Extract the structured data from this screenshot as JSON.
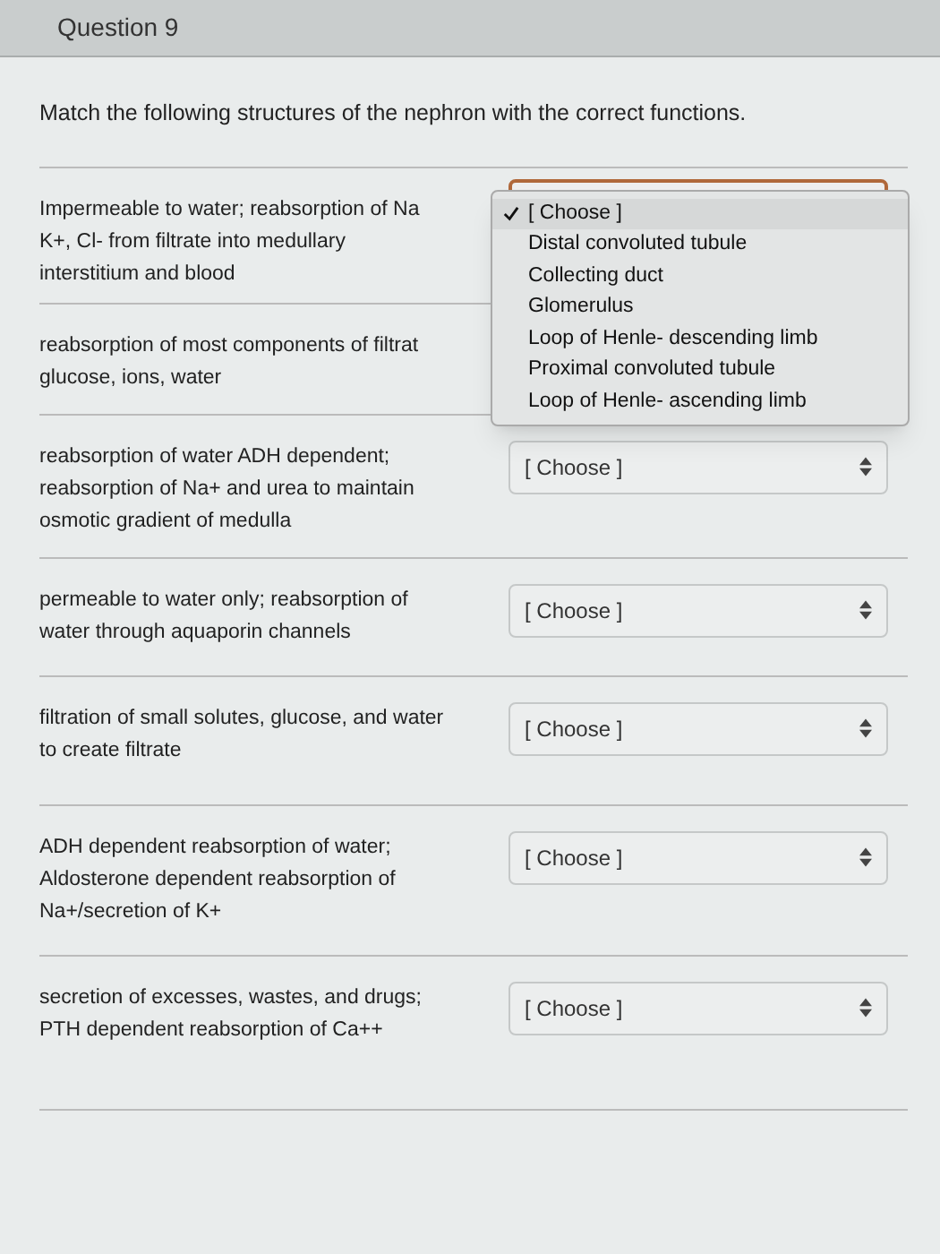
{
  "question": {
    "title": "Question 9",
    "prompt": "Match the following structures of the nephron with the correct functions.",
    "rows": [
      {
        "text": "Impermeable to water; reabsorption of Na\nK+, Cl- from filtrate into medullary\ninterstitium and blood",
        "select": {
          "open": true,
          "options": [
            {
              "label": "[ Choose ]",
              "selected": true
            },
            {
              "label": "Distal convoluted tubule",
              "selected": false
            },
            {
              "label": "Collecting duct",
              "selected": false
            },
            {
              "label": "Glomerulus",
              "selected": false
            },
            {
              "label": "Loop of Henle- descending limb",
              "selected": false
            },
            {
              "label": "Proximal convoluted tubule",
              "selected": false
            },
            {
              "label": "Loop of Henle- ascending limb",
              "selected": false
            }
          ]
        }
      },
      {
        "text": "reabsorption of most components of filtrat\nglucose, ions, water"
      },
      {
        "text": "reabsorption of water ADH dependent;\nreabsorption of Na+ and urea to maintain\nosmotic gradient of medulla",
        "select": {
          "open": false,
          "value": "[ Choose ]"
        }
      },
      {
        "text": "permeable to water only; reabsorption of\nwater through aquaporin channels",
        "select": {
          "open": false,
          "value": "[ Choose ]"
        }
      },
      {
        "text": "filtration of small solutes, glucose, and water\nto create filtrate",
        "select": {
          "open": false,
          "value": "[ Choose ]"
        }
      },
      {
        "text": "ADH dependent reabsorption of water;\nAldosterone dependent reabsorption of\nNa+/secretion of K+",
        "select": {
          "open": false,
          "value": "[ Choose ]"
        }
      },
      {
        "text": "secretion of excesses, wastes, and drugs;\nPTH dependent reabsorption of Ca++",
        "select": {
          "open": false,
          "value": "[ Choose ]"
        }
      }
    ]
  }
}
